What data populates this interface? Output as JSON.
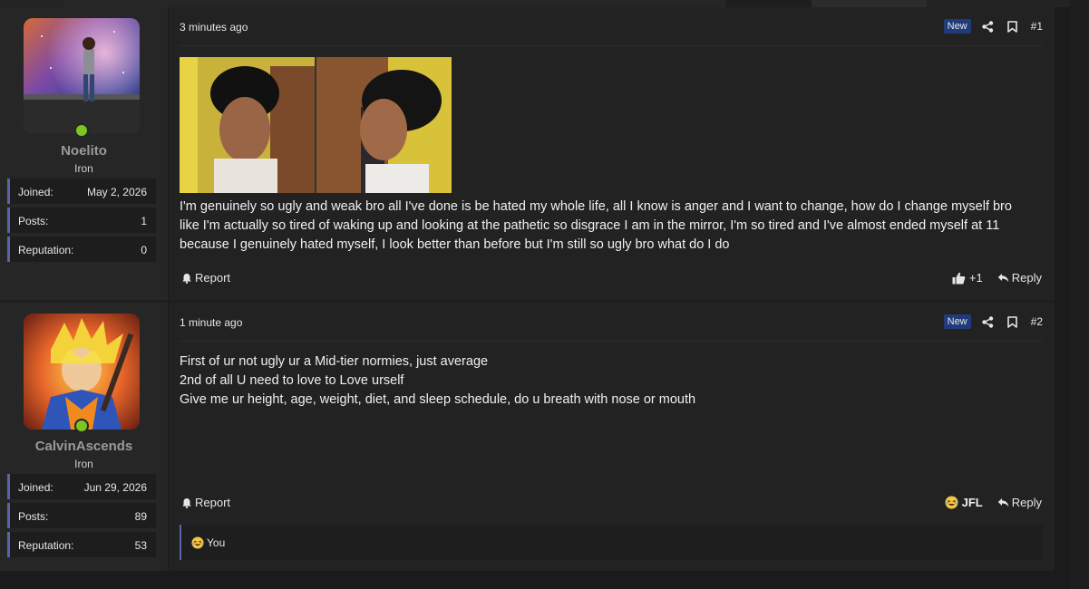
{
  "posts": [
    {
      "user": {
        "name": "Noelito",
        "rank": "Iron",
        "stats": [
          {
            "label": "Joined:",
            "value": "May 2, 2026"
          },
          {
            "label": "Posts:",
            "value": "1"
          },
          {
            "label": "Reputation:",
            "value": "0"
          }
        ]
      },
      "time": "3 minutes ago",
      "badge": "New",
      "number": "#1",
      "body_lines": [
        "I'm genuinely so ugly and weak bro all I've done is be hated my whole life, all I know is anger and I want to change, how do I change myself bro",
        "like I'm actually so tired of waking up and looking at the pathetic so disgrace I am in the mirror, I'm so tired and I've almost ended myself at 11",
        "because I genuinely hated myself, I look better than before but I'm still so ugly bro what do I do"
      ],
      "report_label": "Report",
      "reaction_count": "+1",
      "reply_label": "Reply"
    },
    {
      "user": {
        "name": "CalvinAscends",
        "rank": "Iron",
        "stats": [
          {
            "label": "Joined:",
            "value": "Jun 29, 2026"
          },
          {
            "label": "Posts:",
            "value": "89"
          },
          {
            "label": "Reputation:",
            "value": "53"
          }
        ]
      },
      "time": "1 minute ago",
      "badge": "New",
      "number": "#2",
      "body_lines": [
        "First of ur not ugly ur a Mid-tier normies, just average",
        "2nd of all U need to love to Love urself",
        "Give me ur height, age, weight, diet, and sleep schedule, do u breath with nose or mouth"
      ],
      "report_label": "Report",
      "reaction_label": "JFL",
      "reply_label": "Reply",
      "reactions_summary": "You"
    }
  ],
  "colors": {
    "online": "#7cc623",
    "accent": "#5d62a8",
    "badge": "#213a7a"
  }
}
